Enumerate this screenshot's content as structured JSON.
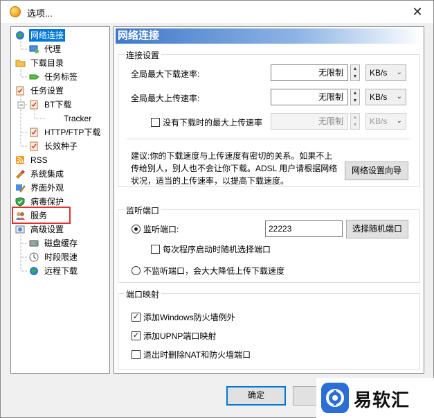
{
  "window": {
    "title": "选项..."
  },
  "tree": {
    "items": [
      {
        "label": "网络连接",
        "icon": "globe-network-icon",
        "selected": true
      },
      {
        "label": "代理",
        "icon": "proxy-computer-icon"
      },
      {
        "label": "下载目录",
        "icon": "folder-icon"
      },
      {
        "label": "任务标签",
        "icon": "tag-icon"
      },
      {
        "label": "任务设置",
        "icon": "clipboard-icon"
      },
      {
        "label": "BT下载",
        "icon": "clipboard-icon"
      },
      {
        "label": "Tracker",
        "icon": "none"
      },
      {
        "label": "HTTP/FTP下载",
        "icon": "clipboard-icon"
      },
      {
        "label": "长效种子",
        "icon": "clipboard-icon"
      },
      {
        "label": "RSS",
        "icon": "rss-icon"
      },
      {
        "label": "系统集成",
        "icon": "integration-icon"
      },
      {
        "label": "界面外观",
        "icon": "appearance-icon"
      },
      {
        "label": "病毒保护",
        "icon": "shield-icon"
      },
      {
        "label": "服务",
        "icon": "users-icon"
      },
      {
        "label": "高级设置",
        "icon": "advanced-icon"
      },
      {
        "label": "磁盘缓存",
        "icon": "disk-icon"
      },
      {
        "label": "时段限速",
        "icon": "schedule-icon"
      },
      {
        "label": "远程下载",
        "icon": "remote-globe-icon"
      }
    ]
  },
  "panel": {
    "header": "网络连接",
    "connection": {
      "title": "连接设置",
      "download_label": "全局最大下载速率:",
      "download_value": "无限制",
      "download_unit": "KB/s",
      "upload_label": "全局最大上传速率:",
      "upload_value": "无限制",
      "upload_unit": "KB/s",
      "idle_upload_label": "没有下载时的最大上传速率",
      "idle_upload_value": "无限制",
      "idle_upload_unit": "KB/s",
      "advice": "建议:你的下载速度与上传速度有密切的关系。如果不上传给别人，别人也不会让你下载。ADSL 用户请根据网络状况，适当的上传速率，以提高下载速度。",
      "wizard_button": "网络设置向导"
    },
    "listen": {
      "title": "监听端口",
      "port_label": "监听端口:",
      "port_value": "22223",
      "random_button": "选择随机端口",
      "random_each_start": "每次程序启动时随机选择端口",
      "no_listen": "不监听端口，会大大降低上传下载速度"
    },
    "mapping": {
      "title": "端口映射",
      "firewall": "添加Windows防火墙例外",
      "upnp": "添加UPNP端口映射",
      "remove_on_exit": "退出时删除NAT和防火墙端口"
    }
  },
  "footer": {
    "ok": "确定"
  },
  "watermark": {
    "text": "易软汇"
  }
}
